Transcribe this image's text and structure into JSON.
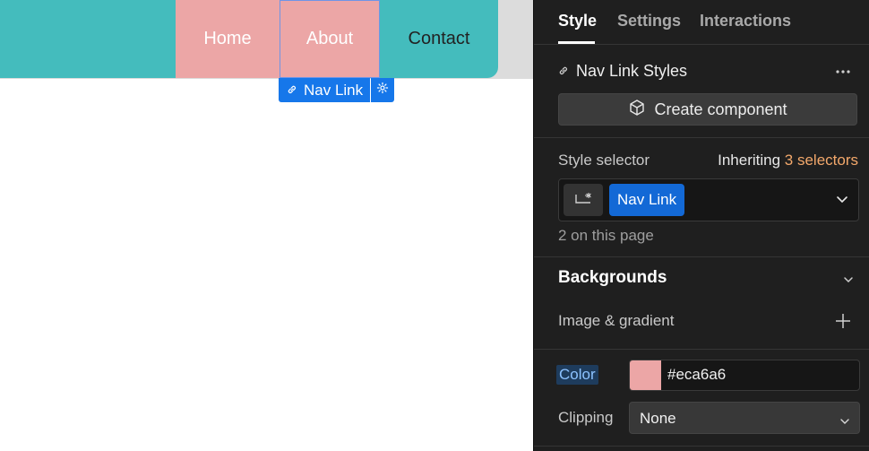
{
  "canvas": {
    "nav": {
      "links": [
        "Home",
        "About",
        "Contact"
      ],
      "bar_color": "#44bcbd",
      "link_bg": "#eca6a6"
    },
    "selection_label": "Nav Link",
    "selection_icons": [
      "link-icon",
      "gear-icon"
    ]
  },
  "panel": {
    "tabs": [
      "Style",
      "Settings",
      "Interactions"
    ],
    "active_tab": "Style",
    "component": {
      "title": "Nav Link Styles",
      "more_icon": "more-icon",
      "create_button": "Create component"
    },
    "selector": {
      "label": "Style selector",
      "inheriting_prefix": "Inheriting",
      "inheriting_link": "3 selectors",
      "chip": "Nav Link",
      "count_text": "2 on this page"
    },
    "backgrounds": {
      "heading": "Backgrounds",
      "image_gradient": "Image & gradient",
      "color_label": "Color",
      "color_value": "#eca6a6",
      "clipping_label": "Clipping",
      "clipping_value": "None"
    },
    "accent": "#1677ea",
    "inherit_color": "#f3a86b"
  }
}
